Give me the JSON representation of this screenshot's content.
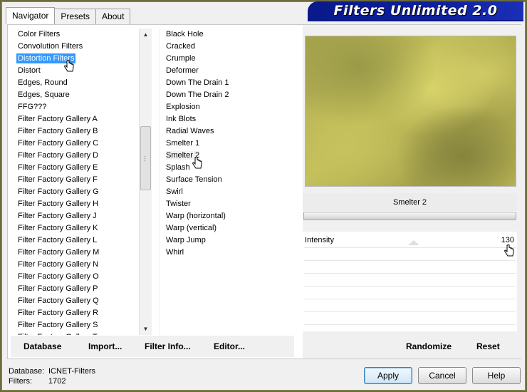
{
  "tabs": [
    {
      "label": "Navigator"
    },
    {
      "label": "Presets"
    },
    {
      "label": "About"
    }
  ],
  "banner": "Filters Unlimited 2.0",
  "categories": [
    "Color Filters",
    "Convolution Filters",
    "Distortion Filters",
    "Distort",
    "Edges, Round",
    "Edges, Square",
    "FFG???",
    "Filter Factory Gallery A",
    "Filter Factory Gallery B",
    "Filter Factory Gallery C",
    "Filter Factory Gallery D",
    "Filter Factory Gallery E",
    "Filter Factory Gallery F",
    "Filter Factory Gallery G",
    "Filter Factory Gallery H",
    "Filter Factory Gallery J",
    "Filter Factory Gallery K",
    "Filter Factory Gallery L",
    "Filter Factory Gallery M",
    "Filter Factory Gallery N",
    "Filter Factory Gallery O",
    "Filter Factory Gallery P",
    "Filter Factory Gallery Q",
    "Filter Factory Gallery R",
    "Filter Factory Gallery S",
    "Filter Factory Gallery T"
  ],
  "selected_category": "Distortion Filters",
  "filters": [
    "Black Hole",
    "Cracked",
    "Crumple",
    "Deformer",
    "Down The Drain 1",
    "Down The Drain 2",
    "Explosion",
    "Ink Blots",
    "Radial Waves",
    "Smelter 1",
    "Smelter 2",
    "Splash",
    "Surface Tension",
    "Swirl",
    "Twister",
    "Warp (horizontal)",
    "Warp (vertical)",
    "Warp Jump",
    "Whirl"
  ],
  "selected_filter": "Smelter 2",
  "preview": {
    "filter_name": "Smelter 2"
  },
  "controls": {
    "intensity_label": "Intensity",
    "intensity_value": "130"
  },
  "bottom_links": {
    "database": "Database",
    "import": "Import...",
    "filter_info": "Filter Info...",
    "editor": "Editor...",
    "randomize": "Randomize",
    "reset": "Reset"
  },
  "status": {
    "database_label": "Database:",
    "database_value": "ICNET-Filters",
    "filters_label": "Filters:",
    "filters_value": "1702"
  },
  "buttons": {
    "apply": "Apply",
    "cancel": "Cancel",
    "help": "Help"
  },
  "colors": {
    "accent": "#3399ff",
    "banner": "#0d1f9c"
  }
}
